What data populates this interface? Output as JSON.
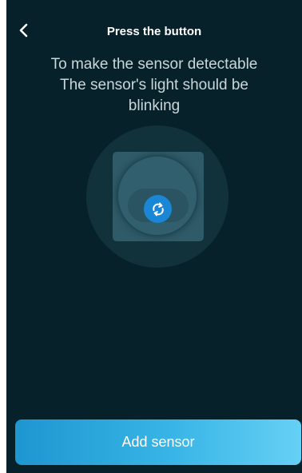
{
  "header": {
    "title": "Press the button",
    "back_icon": "chevron-left-icon"
  },
  "instructions": {
    "line1": "To make the sensor detectable",
    "line2": "The sensor's light should be",
    "line3": "blinking"
  },
  "illustration": {
    "icon": "sync-icon"
  },
  "footer": {
    "add_label": "Add sensor"
  },
  "colors": {
    "background": "#06212a",
    "accent": "#1a87d6",
    "button_gradient_start": "#1e96d0",
    "button_gradient_end": "#66d0f5"
  }
}
